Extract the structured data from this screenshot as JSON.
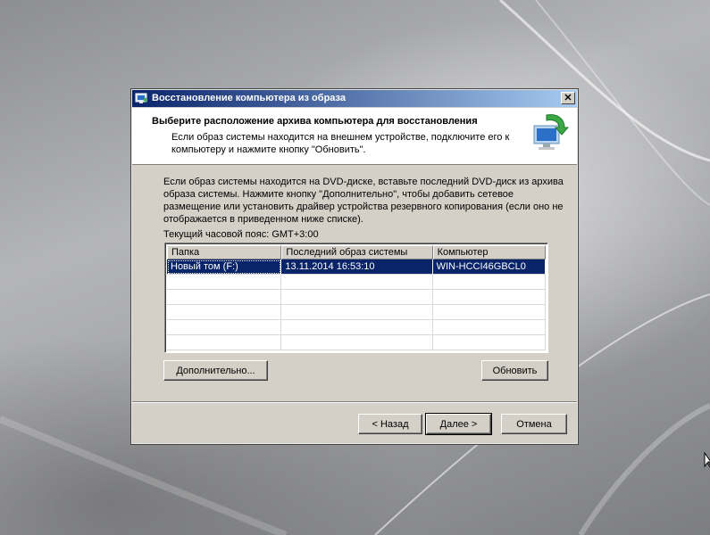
{
  "window": {
    "title": "Восстановление компьютера из образа",
    "close_label": "✕"
  },
  "header": {
    "title": "Выберите расположение архива компьютера для восстановления",
    "subtitle": "Если образ системы находится на внешнем устройстве, подключите его к компьютеру и нажмите кнопку \"Обновить\"."
  },
  "main": {
    "instructions": "Если образ системы находится на DVD-диске, вставьте последний DVD-диск из архива образа системы. Нажмите кнопку \"Дополнительно\", чтобы добавить сетевое размещение или установить драйвер устройства резервного копирования (если оно не отображается в приведенном ниже списке).",
    "timezone": "Текущий часовой пояс: GMT+3:00"
  },
  "table": {
    "columns": [
      "Папка",
      "Последний образ системы",
      "Компьютер"
    ],
    "rows": [
      [
        "Новый том (F:)",
        "13.11.2014 16:53:10",
        "WIN-HCCI46GBCL0"
      ],
      [
        "",
        "",
        ""
      ],
      [
        "",
        "",
        ""
      ],
      [
        "",
        "",
        ""
      ],
      [
        "",
        "",
        ""
      ],
      [
        "",
        "",
        ""
      ]
    ],
    "selected_row": 0
  },
  "buttons": {
    "advanced": "Дополнительно...",
    "refresh": "Обновить",
    "back": "< Назад",
    "next": "Далее >",
    "cancel": "Отмена"
  },
  "icons": {
    "title_icon": "restore-computer-icon",
    "header_icon": "computer-restore-arrow-icon"
  },
  "colors": {
    "title_bar_start": "#0a246a",
    "title_bar_end": "#a6caf0",
    "selection": "#0a246a",
    "dialog_face": "#d4d0c8"
  }
}
